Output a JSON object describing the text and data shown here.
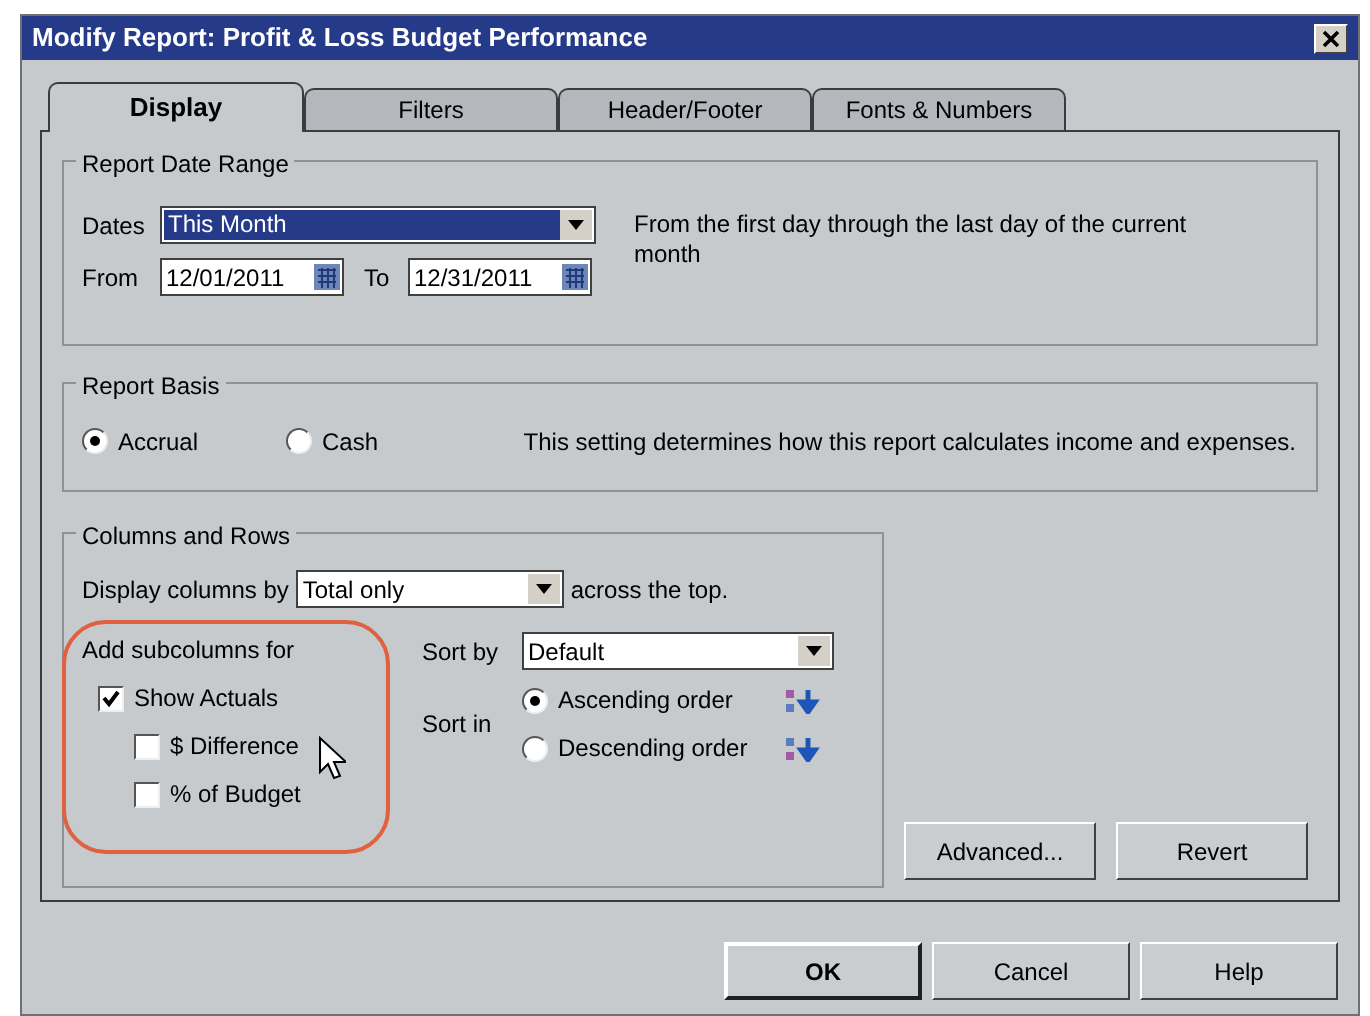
{
  "window": {
    "title": "Modify Report: Profit & Loss Budget Performance"
  },
  "tabs": [
    {
      "label": "Display",
      "selected": true
    },
    {
      "label": "Filters",
      "selected": false
    },
    {
      "label": "Header/Footer",
      "selected": false
    },
    {
      "label": "Fonts & Numbers",
      "selected": false
    }
  ],
  "date_range": {
    "legend": "Report Date Range",
    "dates_label": "Dates",
    "dates_value": "This Month",
    "from_label": "From",
    "from_value": "12/01/2011",
    "to_label": "To",
    "to_value": "12/31/2011",
    "description": "From the first day through the last day of the current month"
  },
  "report_basis": {
    "legend": "Report Basis",
    "options": [
      {
        "label": "Accrual",
        "selected": true
      },
      {
        "label": "Cash",
        "selected": false
      }
    ],
    "description": "This setting determines how this report calculates income and expenses."
  },
  "columns_rows": {
    "legend": "Columns and Rows",
    "display_label": "Display columns by",
    "display_value": "Total only",
    "display_suffix": "across the top.",
    "subcolumns_label": "Add subcolumns for",
    "subcolumns": [
      {
        "label": "Show Actuals",
        "checked": true,
        "children": [
          {
            "label": "$ Difference",
            "checked": false
          },
          {
            "label": "% of Budget",
            "checked": false
          }
        ]
      }
    ],
    "sort_by_label": "Sort by",
    "sort_by_value": "Default",
    "sort_in_label": "Sort in",
    "sort_orders": [
      {
        "label": "Ascending order",
        "selected": true,
        "kind": "ascending"
      },
      {
        "label": "Descending order",
        "selected": false,
        "kind": "descending"
      }
    ]
  },
  "panel_buttons": [
    "Advanced...",
    "Revert"
  ],
  "buttons": [
    {
      "label": "OK",
      "default": true
    },
    {
      "label": "Cancel",
      "default": false
    },
    {
      "label": "Help",
      "default": false
    }
  ]
}
